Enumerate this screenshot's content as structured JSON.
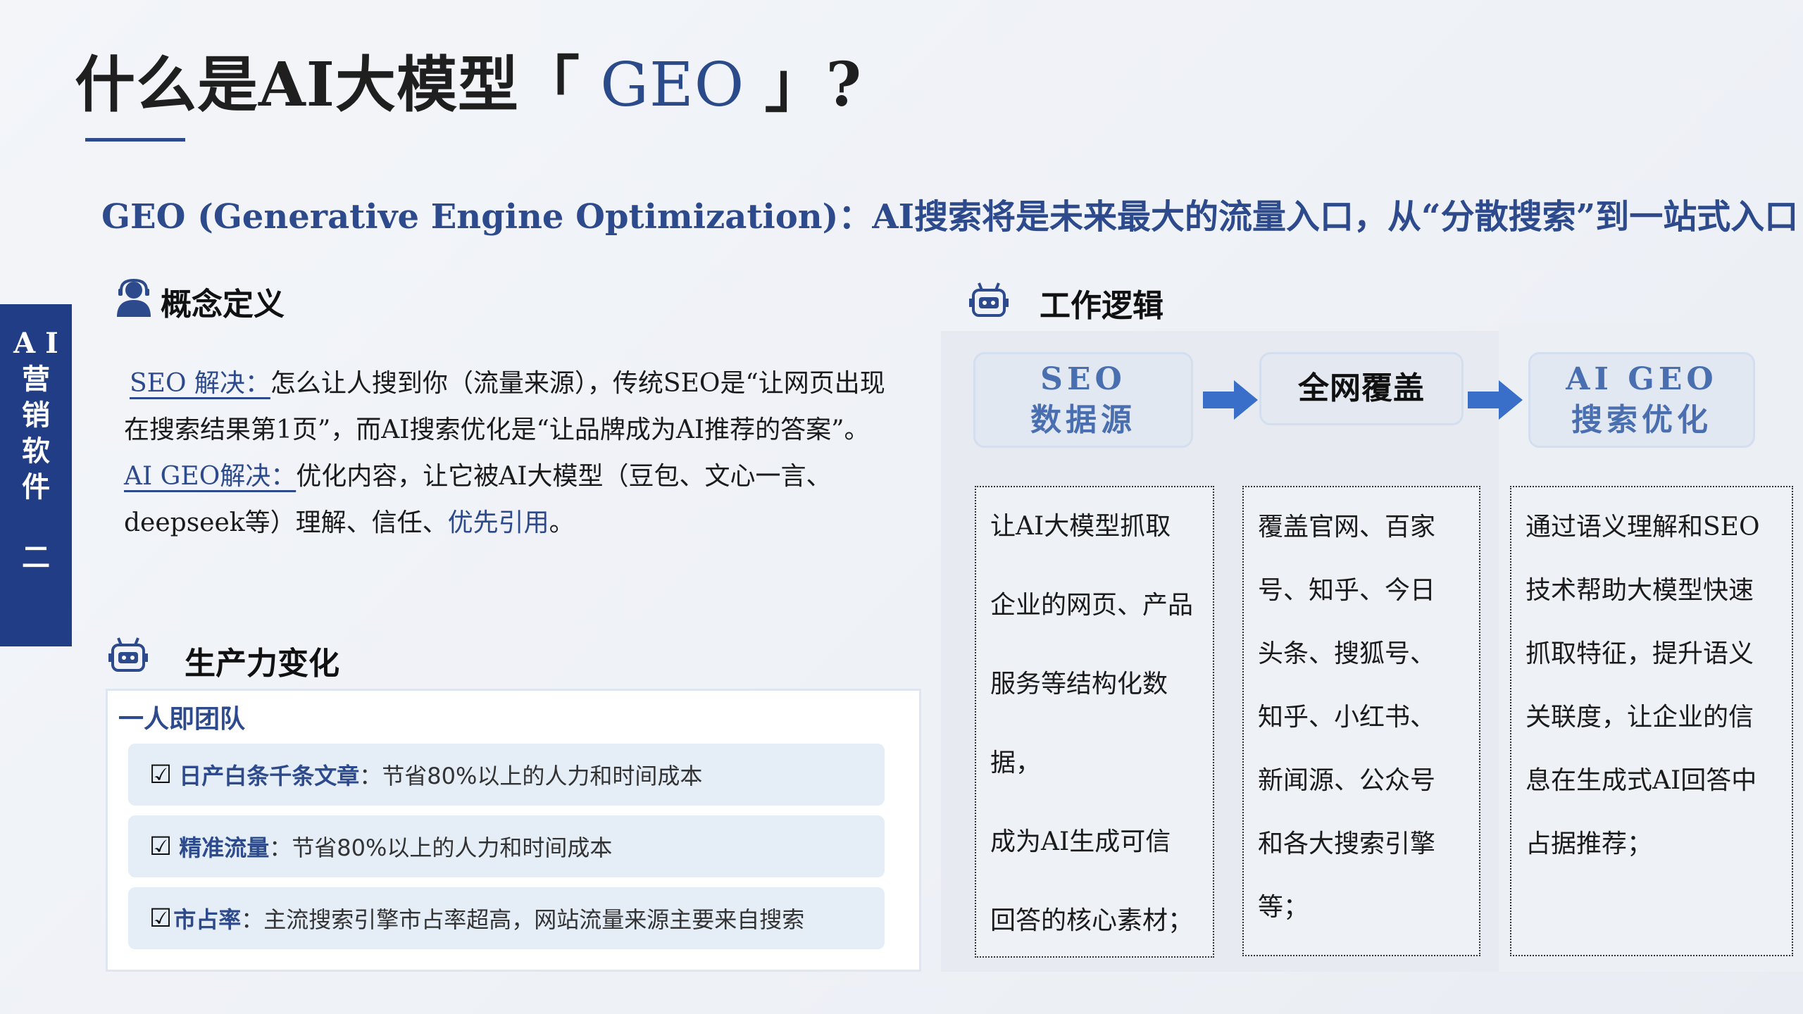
{
  "title": {
    "prefix": "什么是AI大模型「",
    "geo": " GEO ",
    "suffix": "」?"
  },
  "subtitle": "GEO (Generative Engine Optimization)：AI搜索将是未来最大的流量入口，从“分散搜索”到一站式入口",
  "sidetab": {
    "chars": [
      "A I",
      "营",
      "销",
      "软",
      "件"
    ],
    "number": "二"
  },
  "concept": {
    "heading": "概念定义",
    "seo_label": "SEO 解决：",
    "seo_text": "怎么让人搜到你（流量来源），传统SEO是“让网页出现在搜索结果第1页”，而AI搜索优化是“让品牌成为AI推荐的答案”。",
    "geo_label": "AI GEO解决：",
    "geo_text": "优化内容，让它被AI大模型（豆包、文心一言、deepseek等）理解、信任、",
    "geo_highlight": "优先引用",
    "geo_end": "。"
  },
  "productivity": {
    "heading": "生产力变化",
    "box_title": "一人即团队",
    "items": [
      {
        "key": "日产白条千条文章",
        "text": "：节省80%以上的人力和时间成本"
      },
      {
        "key": "精准流量",
        "text": "：节省80%以上的人力和时间成本"
      },
      {
        "key": "市占率",
        "text": "：主流搜索引擎市占率超高，网站流量来源主要来自搜索"
      }
    ]
  },
  "logic": {
    "heading": "工作逻辑",
    "stages": [
      {
        "line1": "SEO",
        "line2": "数据源"
      },
      {
        "line1": "全网覆盖",
        "line2": ""
      },
      {
        "line1": "AI GEO",
        "line2": "搜索优化"
      }
    ],
    "descriptions": [
      [
        "让AI大模型抓取",
        "企业的网页、产品",
        "服务等结构化数据，",
        "成为AI生成可信",
        "回答的核心素材；"
      ],
      [
        "覆盖官网、百家",
        "号、知乎、今日",
        "头条、搜狐号、",
        "知乎、小红书、",
        "新闻源、公众号",
        "和各大搜索引擎",
        "等；"
      ],
      [
        "通过语义理解和SEO",
        "技术帮助大模型快速",
        "抓取特征，提升语义",
        "关联度，让企业的信",
        "息在生成式AI回答中",
        "占据推荐；"
      ]
    ]
  },
  "colors": {
    "brand_blue": "#2d4a8c",
    "sidetab_bg": "#203d86",
    "stage_text": "#4a6fb0",
    "arrow": "#3a6fc9"
  }
}
